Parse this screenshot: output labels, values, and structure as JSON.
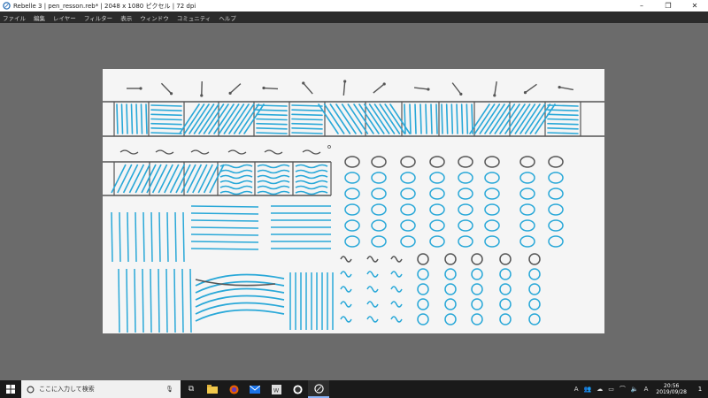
{
  "window": {
    "title": "Rebelle 3 | pen_resson.reb* | 2048 x 1080 ピクセル | 72 dpi",
    "minimize": "–",
    "maximize": "❐",
    "close": "✕"
  },
  "menu": [
    "ファイル",
    "編集",
    "レイヤー",
    "フィルター",
    "表示",
    "ウィンドウ",
    "コミュニティ",
    "ヘルプ"
  ],
  "taskbar": {
    "search_placeholder": "ここに入力して検索",
    "apps": [
      "task-view",
      "file-explorer",
      "firefox",
      "mail",
      "word",
      "whatsapp",
      "rebelle"
    ],
    "tray_lang": "A",
    "tray_ime": "A",
    "time": "20:56",
    "date": "2019/09/28",
    "notifications": "1"
  },
  "colors": {
    "stroke_blue": "#29a8d8",
    "grid_line": "#555555",
    "arrow": "#555555"
  }
}
